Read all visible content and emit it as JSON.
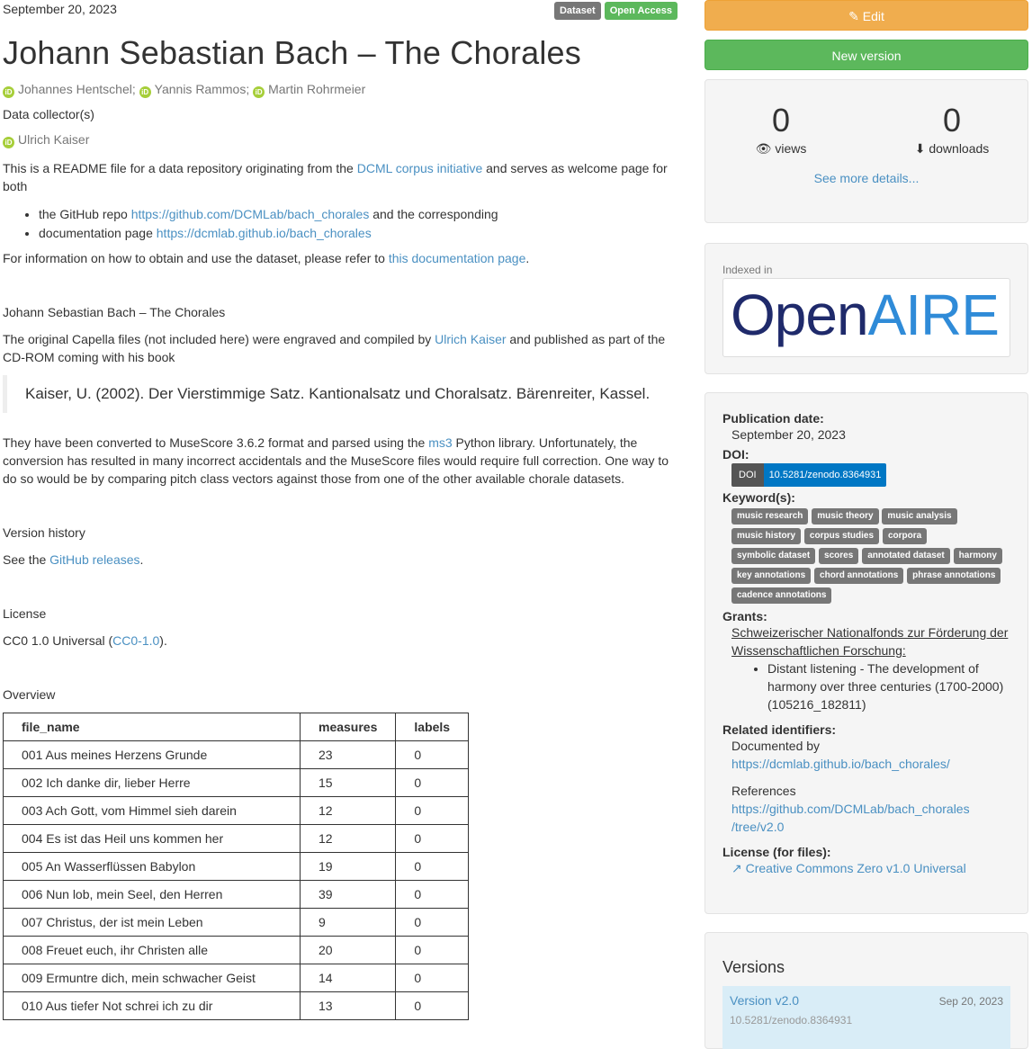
{
  "record": {
    "publication_date_top": "September 20, 2023",
    "badges": [
      "Dataset",
      "Open Access"
    ],
    "title": "Johann Sebastian Bach – The Chorales",
    "authors": [
      "Johannes Hentschel",
      "Yannis Rammos",
      "Martin Rohrmeier"
    ],
    "collector_label": "Data collector(s)",
    "collector": "Ulrich Kaiser"
  },
  "description": {
    "intro_pre": "This is a README file for a data repository originating from the ",
    "intro_link": "DCML corpus initiative",
    "intro_post": " and serves as welcome page for both",
    "bullets": [
      {
        "pre": "the GitHub repo ",
        "link": "https://github.com/DCMLab/bach_chorales",
        "post": " and the corresponding"
      },
      {
        "pre": "documentation page ",
        "link": "https://dcmlab.github.io/bach_chorales",
        "post": ""
      }
    ],
    "refer_pre": "For information on how to obtain and use the dataset, please refer to ",
    "refer_link": "this documentation page",
    "refer_post": ".",
    "heading_title": "Johann Sebastian Bach – The Chorales",
    "capella_pre": "The original Capella files (not included here) were engraved and compiled by ",
    "capella_link": "Ulrich Kaiser",
    "capella_post": " and published as part of the CD-ROM coming with his book",
    "quote": "Kaiser, U. (2002). Der Vierstimmige Satz. Kantionalsatz und Choralsatz. Bärenreiter, Kassel.",
    "converted_pre": "They have been converted to MuseScore 3.6.2 format and parsed using the ",
    "converted_link": "ms3",
    "converted_post": " Python library. Unfortunately, the conversion has resulted in many incorrect accidentals and the MuseScore files would require full correction. One way to do so would be by comparing pitch class vectors against those from one of the other available chorale datasets.",
    "version_history": "Version history",
    "see_pre": "See the ",
    "see_link": "GitHub releases",
    "see_post": ".",
    "license_heading": "License",
    "license_pre": "CC0 1.0 Universal (",
    "license_link": "CC0-1.0",
    "license_post": ").",
    "overview": "Overview"
  },
  "table": {
    "headers": [
      "file_name",
      "measures",
      "labels"
    ],
    "rows": [
      [
        "001 Aus meines Herzens Grunde",
        "23",
        "0"
      ],
      [
        "002 Ich danke dir, lieber Herre",
        "15",
        "0"
      ],
      [
        "003 Ach Gott, vom Himmel sieh darein",
        "12",
        "0"
      ],
      [
        "004 Es ist das Heil uns kommen her",
        "12",
        "0"
      ],
      [
        "005 An Wasserflüssen Babylon",
        "19",
        "0"
      ],
      [
        "006 Nun lob, mein Seel, den Herren",
        "39",
        "0"
      ],
      [
        "007 Christus, der ist mein Leben",
        "9",
        "0"
      ],
      [
        "008 Freuet euch, ihr Christen alle",
        "20",
        "0"
      ],
      [
        "009 Ermuntre dich, mein schwacher Geist",
        "14",
        "0"
      ],
      [
        "010 Aus tiefer Not schrei ich zu dir",
        "13",
        "0"
      ]
    ]
  },
  "sidebar": {
    "edit": "Edit",
    "new_version": "New version",
    "views_count": "0",
    "views_label": "views",
    "downloads_count": "0",
    "downloads_label": "downloads",
    "more_details": "See more details...",
    "indexed_in": "Indexed in",
    "openaire_open": "Open",
    "openaire_aire": "AIRE",
    "pub_date_label": "Publication date:",
    "pub_date": "September 20, 2023",
    "doi_label": "DOI:",
    "doi_prefix": "DOI",
    "doi": "10.5281/zenodo.8364931",
    "keywords_label": "Keyword(s):",
    "keywords": [
      "music research",
      "music theory",
      "music analysis",
      "music history",
      "corpus studies",
      "corpora",
      "symbolic dataset",
      "scores",
      "annotated dataset",
      "harmony",
      "key annotations",
      "chord annotations",
      "phrase annotations",
      "cadence annotations"
    ],
    "grants_label": "Grants:",
    "grant_funder": "Schweizerischer Nationalfonds zur Förderung der Wissenschaftlichen Forschung:",
    "grant_item": "Distant listening - The development of harmony over three centuries (1700-2000) (105216_182811)",
    "related_label": "Related identifiers:",
    "documented_by": "Documented by",
    "documented_link": "https://dcmlab.github.io/bach_chorales/",
    "references": "References",
    "references_link_1": "https://github.com/DCMLab/bach_chorales",
    "references_link_2": "/tree/v2.0",
    "license_label": "License (for files):",
    "license_link": "Creative Commons Zero v1.0 Universal",
    "versions_heading": "Versions",
    "version_name": "Version v2.0",
    "version_date": "Sep 20, 2023",
    "version_doi": "10.5281/zenodo.8364931"
  },
  "colors": {
    "accent": "#4a90c2",
    "edit": "#f0ad4e",
    "new": "#5cb85c",
    "orcid": "#a6ce39",
    "openaire_dark": "#1f2a6b",
    "openaire_light": "#2f8bd8"
  }
}
